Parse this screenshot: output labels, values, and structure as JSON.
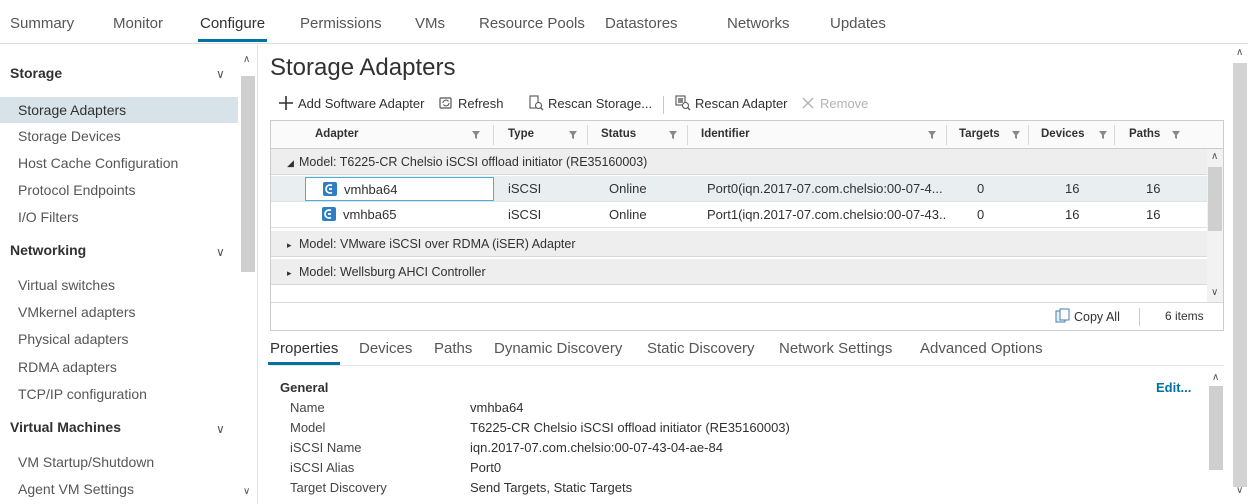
{
  "top_tabs": [
    "Summary",
    "Monitor",
    "Configure",
    "Permissions",
    "VMs",
    "Resource Pools",
    "Datastores",
    "Networks",
    "Updates"
  ],
  "sidebar": {
    "storage": {
      "title": "Storage",
      "items": [
        "Storage Adapters",
        "Storage Devices",
        "Host Cache Configuration",
        "Protocol Endpoints",
        "I/O Filters"
      ]
    },
    "networking": {
      "title": "Networking",
      "items": [
        "Virtual switches",
        "VMkernel adapters",
        "Physical adapters",
        "RDMA adapters",
        "TCP/IP configuration"
      ]
    },
    "virtual_machines": {
      "title": "Virtual Machines",
      "items": [
        "VM Startup/Shutdown",
        "Agent VM Settings"
      ]
    },
    "selected": "Storage Adapters"
  },
  "main": {
    "title": "Storage Adapters",
    "toolbar": {
      "add": "Add Software Adapter",
      "refresh": "Refresh",
      "rescan_storage": "Rescan Storage...",
      "rescan_adapter": "Rescan Adapter",
      "remove": "Remove"
    },
    "columns": [
      "Adapter",
      "Type",
      "Status",
      "Identifier",
      "Targets",
      "Devices",
      "Paths"
    ],
    "groups": [
      {
        "label": "Model: T6225-CR Chelsio iSCSI offload initiator (RE35160003)",
        "expanded": true,
        "rows": [
          {
            "adapter": "vmhba64",
            "type": "iSCSI",
            "status": "Online",
            "identifier": "Port0(iqn.2017-07.com.chelsio:00-07-4...",
            "targets": "0",
            "devices": "16",
            "paths": "16"
          },
          {
            "adapter": "vmhba65",
            "type": "iSCSI",
            "status": "Online",
            "identifier": "Port1(iqn.2017-07.com.chelsio:00-07-43...",
            "targets": "0",
            "devices": "16",
            "paths": "16"
          }
        ]
      },
      {
        "label": "Model: VMware iSCSI over RDMA (iSER) Adapter",
        "expanded": false
      },
      {
        "label": "Model: Wellsburg AHCI Controller",
        "expanded": false
      }
    ],
    "footer": {
      "copy_all": "Copy All",
      "count": "6 items"
    }
  },
  "details": {
    "tabs": [
      "Properties",
      "Devices",
      "Paths",
      "Dynamic Discovery",
      "Static Discovery",
      "Network Settings",
      "Advanced Options"
    ],
    "active_tab": "Properties",
    "section": "General",
    "edit": "Edit...",
    "props": [
      {
        "label": "Name",
        "value": "vmhba64"
      },
      {
        "label": "Model",
        "value": "T6225-CR Chelsio iSCSI offload initiator (RE35160003)"
      },
      {
        "label": "iSCSI Name",
        "value": "iqn.2017-07.com.chelsio:00-07-43-04-ae-84"
      },
      {
        "label": "iSCSI Alias",
        "value": "Port0"
      },
      {
        "label": "Target Discovery",
        "value": "Send Targets, Static Targets"
      }
    ]
  },
  "colors": {
    "accent": "#0072a3",
    "selection": "#d8e3e9",
    "icon_blue": "#2f7ec1"
  }
}
